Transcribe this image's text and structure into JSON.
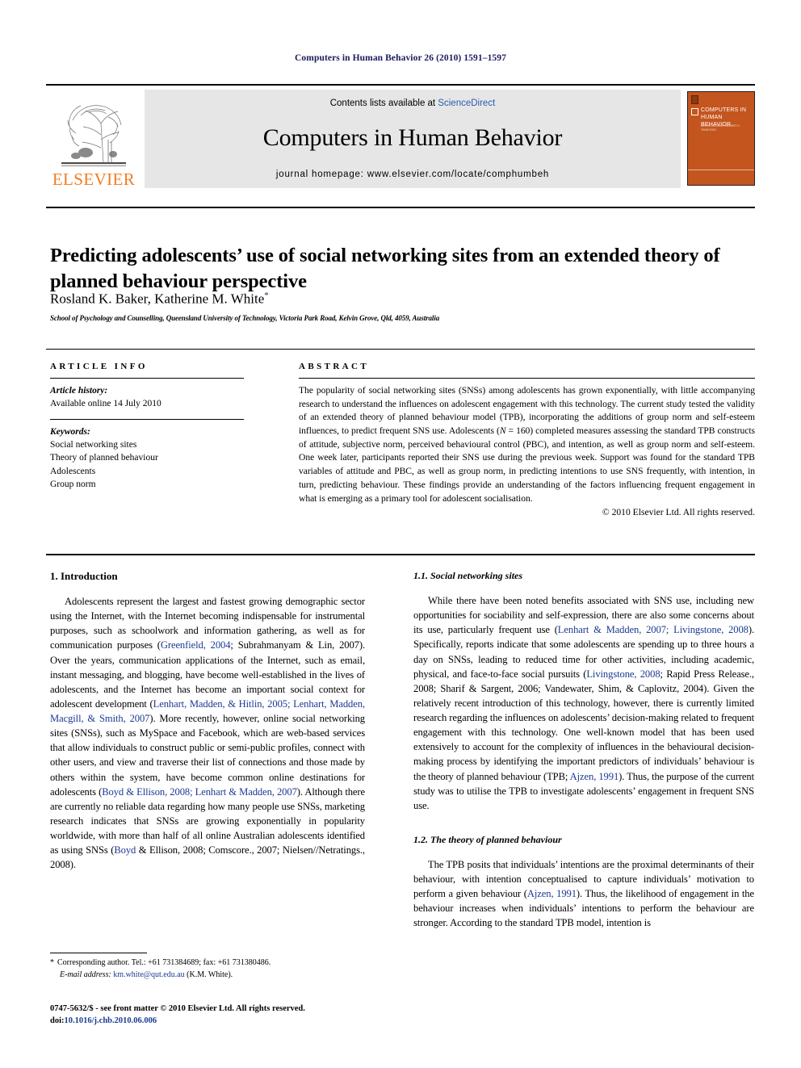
{
  "running_head": "Computers in Human Behavior 26 (2010) 1591–1597",
  "masthead": {
    "contents_prefix": "Contents lists available at ",
    "sciencedirect": "ScienceDirect",
    "journal_title": "Computers in Human Behavior",
    "homepage": "journal homepage: www.elsevier.com/locate/comphumbeh",
    "publisher_wordmark": "ELSEVIER",
    "cover_title": "COMPUTERS IN HUMAN BEHAVIOR",
    "cover_sub": "EDITOR-IN-CHIEF: ROBERT D. TENNYSON",
    "accent_orange": "#F47C20",
    "cover_bg": "#C4551E",
    "link_blue": "#2a5db0"
  },
  "article": {
    "title": "Predicting adolescents’ use of social networking sites from an extended theory of planned behaviour perspective",
    "authors": "Rosland K. Baker, Katherine M. White",
    "author_marker": "*",
    "affiliation": "School of Psychology and Counselling, Queensland University of Technology, Victoria Park Road, Kelvin Grove, Qld, 4059, Australia"
  },
  "article_info": {
    "heading": "ARTICLE INFO",
    "history_label": "Article history:",
    "history_value": "Available online 14 July 2010",
    "keywords_label": "Keywords:",
    "keywords": [
      "Social networking sites",
      "Theory of planned behaviour",
      "Adolescents",
      "Group norm"
    ]
  },
  "abstract": {
    "heading": "ABSTRACT",
    "text": "The popularity of social networking sites (SNSs) among adolescents has grown exponentially, with little accompanying research to understand the influences on adolescent engagement with this technology. The current study tested the validity of an extended theory of planned behaviour model (TPB), incorporating the additions of group norm and self-esteem influences, to predict frequent SNS use. Adolescents (N = 160) completed measures assessing the standard TPB constructs of attitude, subjective norm, perceived behavioural control (PBC), and intention, as well as group norm and self-esteem. One week later, participants reported their SNS use during the previous week. Support was found for the standard TPB variables of attitude and PBC, as well as group norm, in predicting intentions to use SNS frequently, with intention, in turn, predicting behaviour. These findings provide an understanding of the factors influencing frequent engagement in what is emerging as a primary tool for adolescent socialisation.",
    "copyright": "© 2010 Elsevier Ltd. All rights reserved."
  },
  "sections": {
    "introduction_heading": "1. Introduction",
    "intro_paragraph_1": "Adolescents represent the largest and fastest growing demographic sector using the Internet, with the Internet becoming indispensable for instrumental purposes, such as schoolwork and information gathering, as well as for communication purposes (Greenfield, 2004; Subrahmanyam & Lin, 2007). Over the years, communication applications of the Internet, such as email, instant messaging, and blogging, have become well-established in the lives of adolescents, and the Internet has become an important social context for adolescent development (Lenhart, Madden, & Hitlin, 2005; Lenhart, Madden, Macgill, & Smith, 2007). More recently, however, online social networking sites (SNSs), such as MySpace and Facebook, which are web-based services that allow individuals to construct public or semi-public profiles, connect with other users, and view and traverse their list of connections and those made by others within the system, have become common online destinations for adolescents (Boyd & Ellison, 2008; Lenhart & Madden, 2007). Although there are currently no reliable data regarding how many people use SNSs, marketing research indicates that SNSs are growing exponentially in popularity worldwide, with more than half of all online Australian adolescents identified as using SNSs (Boyd & Ellison, 2008; Comscore., 2007; Nielsen//Netratings., 2008).",
    "sns_heading": "1.1. Social networking sites",
    "sns_paragraph": "While there have been noted benefits associated with SNS use, including new opportunities for sociability and self-expression, there are also some concerns about its use, particularly frequent use (Lenhart & Madden, 2007; Livingstone, 2008). Specifically, reports indicate that some adolescents are spending up to three hours a day on SNSs, leading to reduced time for other activities, including academic, physical, and face-to-face social pursuits (Livingstone, 2008; Rapid Press Release., 2008; Sharif & Sargent, 2006; Vandewater, Shim, & Caplovitz, 2004). Given the relatively recent introduction of this technology, however, there is currently limited research regarding the influences on adolescents’ decision-making related to frequent engagement with this technology. One well-known model that has been used extensively to account for the complexity of influences in the behavioural decision-making process by identifying the important predictors of individuals’ behaviour is the theory of planned behaviour (TPB; Ajzen, 1991). Thus, the purpose of the current study was to utilise the TPB to investigate adolescents’ engagement in frequent SNS use.",
    "tpb_heading": "1.2. The theory of planned behaviour",
    "tpb_paragraph": "The TPB posits that individuals’ intentions are the proximal determinants of their behaviour, with intention conceptualised to capture individuals’ motivation to perform a given behaviour (Ajzen, 1991). Thus, the likelihood of engagement in the behaviour increases when individuals’ intentions to perform the behaviour are stronger. According to the standard TPB model, intention is"
  },
  "footer": {
    "corresponding_marker": "*",
    "corresponding_text": "Corresponding author. Tel.: +61 731384689; fax: +61 731380486.",
    "email_label": "E-mail address:",
    "email": "km.white@qut.edu.au",
    "email_owner": "(K.M. White).",
    "issn_line": "0747-5632/$ - see front matter © 2010 Elsevier Ltd. All rights reserved.",
    "doi_label": "doi:",
    "doi": "10.1016/j.chb.2010.06.006"
  }
}
